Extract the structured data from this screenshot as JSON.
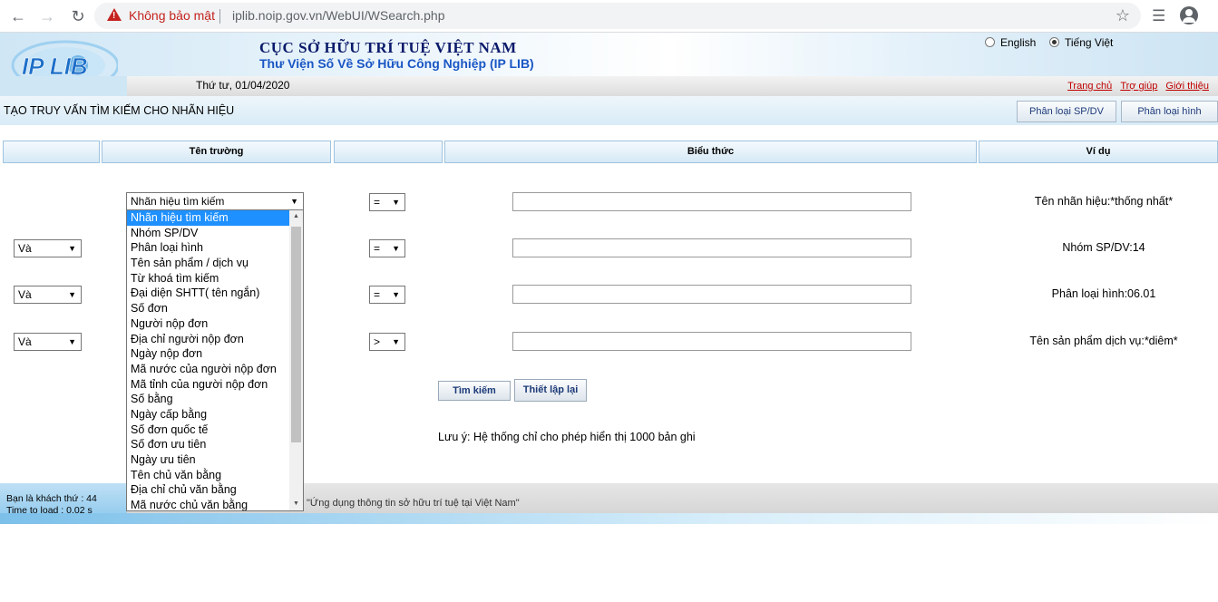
{
  "browser": {
    "security_label": "Không bảo mật",
    "url": "iplib.noip.gov.vn/WebUI/WSearch.php"
  },
  "header": {
    "title": "CỤC SỞ HỮU TRÍ TUỆ VIỆT NAM",
    "subtitle": "Thư Viện Số Về Sở Hữu Công Nghiệp (IP LIB)",
    "logo_text": "IP LIB",
    "lang_english": "English",
    "lang_vietnamese": "Tiếng Việt",
    "date": "Thứ tư, 01/04/2020",
    "links": [
      "Trang chủ",
      "Trợ giúp",
      "Giới thiệu"
    ]
  },
  "section": {
    "title": "TẠO TRUY VẤN TÌM KIẾM CHO NHÃN HIỆU",
    "btn_class_goods": "Phân loại SP/DV",
    "btn_class_figure": "Phân loại hình"
  },
  "table": {
    "col_field": "Tên trường",
    "col_expression": "Biểu thức",
    "col_example": "Ví dụ"
  },
  "rows": [
    {
      "logic": "",
      "field": "Nhãn hiệu tìm kiếm",
      "op": "=",
      "value": "",
      "example": "Tên nhãn hiệu:*thống nhất*"
    },
    {
      "logic": "Và",
      "field": "",
      "op": "=",
      "value": "",
      "example": "Nhóm SP/DV:14"
    },
    {
      "logic": "Và",
      "field": "",
      "op": "=",
      "value": "",
      "example": "Phân loại hình:06.01"
    },
    {
      "logic": "Và",
      "field": "",
      "op": ">",
      "value": "",
      "example": "Tên sản phẩm dịch vụ:*diêm*"
    }
  ],
  "dropdown_options": [
    "Nhãn hiệu tìm kiếm",
    "Nhóm SP/DV",
    "Phân loại hình",
    "Tên sản phẩm / dịch vụ",
    "Từ khoá tìm kiếm",
    "Đại diện SHTT( tên ngắn)",
    "Số đơn",
    "Người nộp đơn",
    "Địa chỉ người nộp đơn",
    "Ngày nộp đơn",
    "Mã nước của người nộp đơn",
    "Mã tỉnh của người nộp đơn",
    "Số bằng",
    "Ngày cấp bằng",
    "Số đơn quốc tế",
    "Số đơn ưu tiên",
    "Ngày ưu tiên",
    "Tên chủ văn bằng",
    "Địa chỉ chủ văn bằng",
    "Mã nước chủ văn bằng"
  ],
  "actions": {
    "search": "Tìm kiếm",
    "reset": "Thiết lập lại"
  },
  "note": "Lưu ý: Hệ thống chỉ cho phép hiển thị 1000 bản ghi",
  "footer": {
    "visitor": "Bạn là khách thứ : 44",
    "load_time": "Time to load : 0.02 s",
    "slogan": "\"Ứng dụng thông tin sở hữu trí tuệ tại Việt Nam\""
  }
}
